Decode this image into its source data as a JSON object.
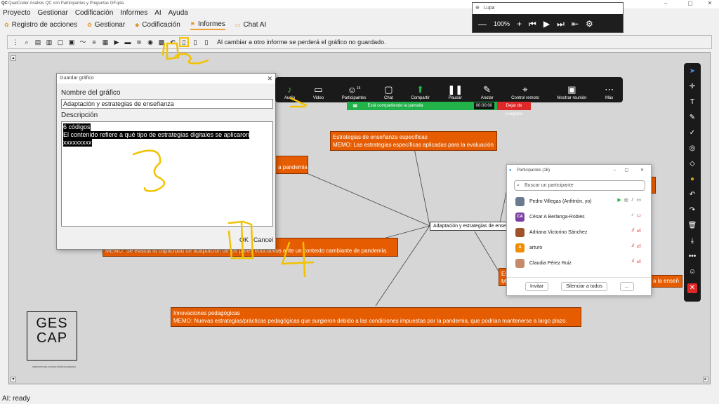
{
  "window": {
    "title": "QualCoder Análisis QC con Participantes y Preguntas GF.qda"
  },
  "menu": [
    "Proyecto",
    "Gestionar",
    "Codificación",
    "Informes",
    "AI",
    "Ayuda"
  ],
  "tabs": [
    {
      "label": "Registro de acciones"
    },
    {
      "label": "Gestionar"
    },
    {
      "label": "Codificación"
    },
    {
      "label": "Informes"
    },
    {
      "label": "Chat AI"
    }
  ],
  "toolbar": {
    "message": "Al cambiar a otro informe se perderá el gráfico no guardado."
  },
  "graph": {
    "center": "Adaptación y estrategias de enseña",
    "nodes": [
      {
        "title": "Estrategias de enseñanza específicas",
        "memo": "MEMO: Las estrategias específicas aplicadas para la evaluación"
      },
      {
        "title": "",
        "memo": "a pandemia"
      },
      {
        "title": "",
        "memo": "MEMO: Se evalúa la capacidad de adaptación de los pares educativos ante un contexto cambiante de pandemia."
      },
      {
        "title": "Innovaciones pedagógicas",
        "memo": "MEMO: Nuevas estrategias/prácticas pedagógicas que surgieron debido a las condiciones impuestas por la pandemia, que podrían mantenerse a largo plazo."
      },
      {
        "title": "Es",
        "memo": "M"
      },
      {
        "title": "",
        "memo": "a la enseñ"
      }
    ]
  },
  "dialog": {
    "title": "Guardar gráfico",
    "name_label": "Nombre del gráfico",
    "name_value": "Adaptación y estrategias de enseñanza",
    "desc_label": "Descripción",
    "desc_lines": [
      "6 códigos",
      "El contenido refiere a qué tipo de estrategias digitales se aplicaron",
      "xxxxxxxxx"
    ],
    "ok_label": "OK",
    "cancel_label": "Cancel"
  },
  "zoom_window": {
    "title": "Lupa",
    "level": "100%"
  },
  "meeting_bar": {
    "items": [
      {
        "label": "Audio",
        "icon": "mic-icon"
      },
      {
        "label": "Video",
        "icon": "video-icon"
      },
      {
        "label": "Participantes",
        "icon": "people-icon",
        "count": "16"
      },
      {
        "label": "Chat",
        "icon": "chat-icon"
      },
      {
        "label": "Compartir",
        "icon": "share-icon"
      },
      {
        "label": "Pausar",
        "icon": "pause-icon"
      },
      {
        "label": "Anotar",
        "icon": "pen-icon"
      },
      {
        "label": "Control remoto",
        "icon": "mouse-icon"
      },
      {
        "label": "Mostrar reunión",
        "icon": "monitor-icon"
      },
      {
        "label": "Más",
        "icon": "more-icon"
      }
    ],
    "sharing_text": "Está compartiendo la pantalla",
    "timer": "00:00:00",
    "stop_label": "Dejar de compartir"
  },
  "participants": {
    "title": "Participantes (16)",
    "search_placeholder": "Buscar un participante",
    "rows": [
      {
        "name": "Pedro Villegas (Anfitrión, yo)",
        "initials": "",
        "color": "#6b7a8f"
      },
      {
        "name": "César A Berlanga-Robles",
        "initials": "CA",
        "color": "#7b3fa3"
      },
      {
        "name": "Adriana Victorino Sánchez",
        "initials": "",
        "color": "#a0522d"
      },
      {
        "name": "arturo",
        "initials": "A",
        "color": "#f08c00"
      },
      {
        "name": "Claudia Pérez Ruiz",
        "initials": "",
        "color": "#c48a6a"
      }
    ],
    "invite_label": "Invitar",
    "mute_all_label": "Silenciar a todos",
    "more_label": "..."
  },
  "logo": {
    "line1": "GES",
    "line2": "CAP",
    "tagline": "SERVICIOS DE CONSULTORÍA ACADÉMICA"
  },
  "annotations": {
    "marks": [
      "1",
      "2",
      "3",
      "4"
    ]
  },
  "status": {
    "text": "AI: ready"
  }
}
